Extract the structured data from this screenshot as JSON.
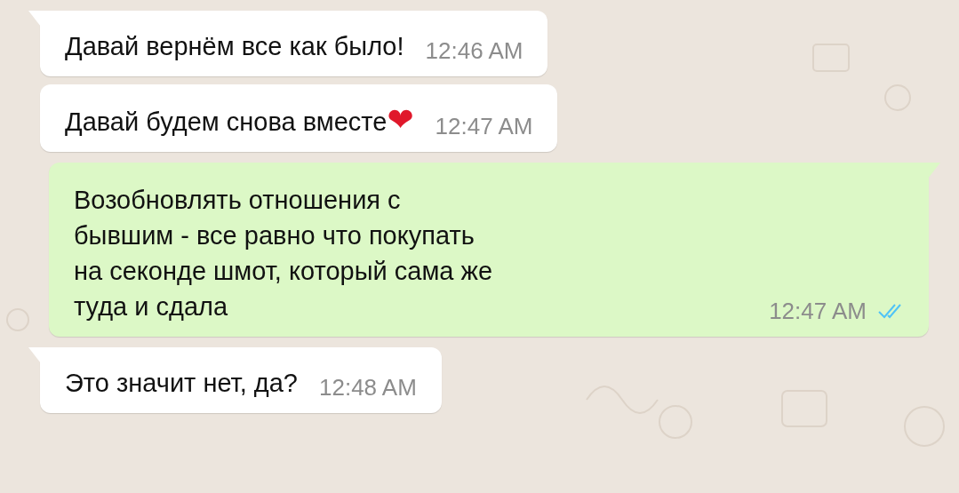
{
  "messages": [
    {
      "kind": "incoming",
      "text": "Давай вернём все как было!",
      "time": "12:46 AM",
      "tail": true
    },
    {
      "kind": "incoming",
      "text": "Давай будем снова вместе",
      "emoji": "❤",
      "time": "12:47 AM",
      "tail": false
    },
    {
      "kind": "outgoing",
      "text": "Возобновлять отношения с\nбывшим - все равно что покупать\nна секонде шмот, который сама же\nтуда и сдала",
      "time": "12:47 AM",
      "tail": true,
      "read": true
    },
    {
      "kind": "incoming",
      "text": "Это значит нет, да?",
      "time": "12:48 AM",
      "tail": true
    }
  ]
}
